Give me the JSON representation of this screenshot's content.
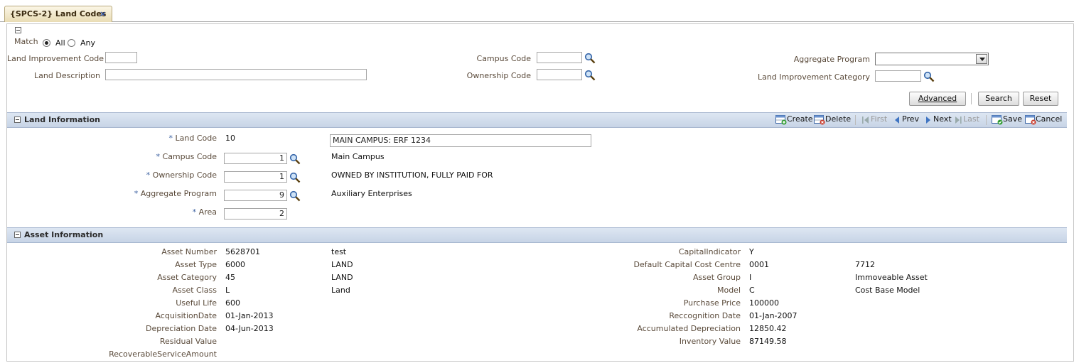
{
  "tab": {
    "title": "{SPCS-2} Land Codes",
    "close": "×"
  },
  "search": {
    "match_label": "Match",
    "all_label": "All",
    "any_label": "Any",
    "land_improvement_code_label": "Land Improvement Code",
    "land_improvement_code_value": "",
    "land_description_label": "Land Description",
    "land_description_value": "",
    "campus_code_label": "Campus Code",
    "campus_code_value": "",
    "ownership_code_label": "Ownership Code",
    "ownership_code_value": "",
    "aggregate_program_label": "Aggregate Program",
    "aggregate_program_value": "",
    "land_improvement_category_label": "Land Improvement Category",
    "land_improvement_category_value": "",
    "advanced_label": "Advanced",
    "search_label": "Search",
    "reset_label": "Reset"
  },
  "land_info": {
    "title": "Land Information",
    "toolbar": {
      "create": "Create",
      "delete": "Delete",
      "first": "First",
      "prev": "Prev",
      "next": "Next",
      "last": "Last",
      "save": "Save",
      "cancel": "Cancel"
    },
    "required_mark": "*",
    "land_code_label": "Land Code",
    "land_code_value": "10",
    "land_description_value": "MAIN CAMPUS: ERF 1234",
    "campus_code_label": "Campus Code",
    "campus_code_value": "1",
    "campus_code_desc": "Main Campus",
    "ownership_code_label": "Ownership Code",
    "ownership_code_value": "1",
    "ownership_code_desc": "OWNED BY INSTITUTION, FULLY PAID FOR",
    "aggregate_program_label": "Aggregate Program",
    "aggregate_program_value": "9",
    "aggregate_program_desc": "Auxiliary Enterprises",
    "area_label": "Area",
    "area_value": "2"
  },
  "asset_info": {
    "title": "Asset Information",
    "left": [
      {
        "label": "Asset Number",
        "value": "5628701",
        "desc": "test"
      },
      {
        "label": "Asset Type",
        "value": "6000",
        "desc": "LAND"
      },
      {
        "label": "Asset Category",
        "value": "45",
        "desc": "LAND"
      },
      {
        "label": "Asset Class",
        "value": "L",
        "desc": "Land"
      },
      {
        "label": "Useful Life",
        "value": "600",
        "desc": ""
      },
      {
        "label": "AcquisitionDate",
        "value": "01-Jan-2013",
        "desc": ""
      },
      {
        "label": "Depreciation Date",
        "value": "04-Jun-2013",
        "desc": ""
      },
      {
        "label": "Residual Value",
        "value": "",
        "desc": ""
      },
      {
        "label": "RecoverableServiceAmount",
        "value": "",
        "desc": ""
      }
    ],
    "right": [
      {
        "label": "CapitalIndicator",
        "value": "Y",
        "desc": ""
      },
      {
        "label": "Default Capital Cost Centre",
        "value": "0001",
        "desc": "7712"
      },
      {
        "label": "Asset Group",
        "value": "I",
        "desc": "Immoveable Asset"
      },
      {
        "label": "Model",
        "value": "C",
        "desc": "Cost Base Model"
      },
      {
        "label": "Purchase Price",
        "value": "100000",
        "desc": ""
      },
      {
        "label": "Reccognition Date",
        "value": "01-Jan-2007",
        "desc": ""
      },
      {
        "label": "Accumulated Depreciation",
        "value": "12850.42",
        "desc": ""
      },
      {
        "label": "Inventory Value",
        "value": "87149.58",
        "desc": ""
      }
    ]
  }
}
